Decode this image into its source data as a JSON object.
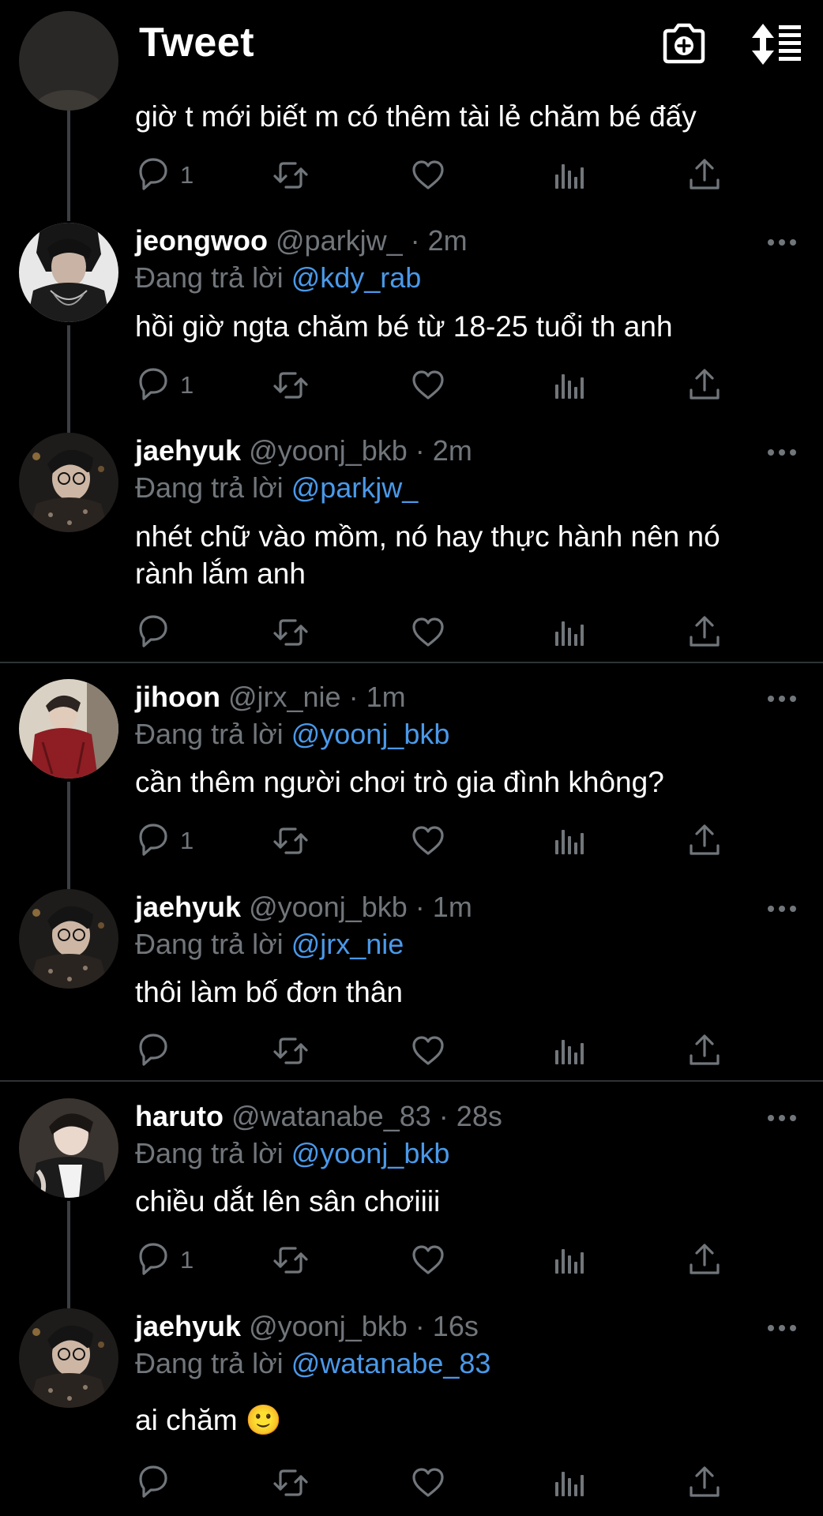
{
  "header": {
    "title": "Tweet",
    "back_icon": "chevron-left-icon",
    "camera_icon": "camera-plus-icon",
    "sort_icon": "sort-list-icon"
  },
  "colors": {
    "background": "#000000",
    "text": "#ffffff",
    "muted": "#71767b",
    "mention": "#4a99e9",
    "thread_line": "#3b3f44",
    "divider": "#2f3336"
  },
  "tweets": [
    {
      "partial": true,
      "text": "giờ t mới biết m có thêm tài lẻ chăm bé đấy",
      "reply_count": "1"
    },
    {
      "name": "jeongwoo",
      "handle": "@parkjw_",
      "sep": "·",
      "time": "2m",
      "reply_label": "Đang trả lời",
      "reply_to": "@kdy_rab",
      "text": "hồi giờ ngta chăm bé từ 18-25 tuổi th anh",
      "reply_count": "1"
    },
    {
      "name": "jaehyuk",
      "handle": "@yoonj_bkb",
      "sep": "·",
      "time": "2m",
      "reply_label": "Đang trả lời",
      "reply_to": "@parkjw_",
      "text": "nhét chữ vào mồm, nó hay thực hành nên nó rành lắm anh",
      "reply_count": ""
    },
    {
      "name": "jihoon",
      "handle": "@jrx_nie",
      "sep": "·",
      "time": "1m",
      "reply_label": "Đang trả lời",
      "reply_to": "@yoonj_bkb",
      "text": "cần thêm người chơi trò gia đình không?",
      "reply_count": "1"
    },
    {
      "name": "jaehyuk",
      "handle": "@yoonj_bkb",
      "sep": "·",
      "time": "1m",
      "reply_label": "Đang trả lời",
      "reply_to": "@jrx_nie",
      "text": "thôi làm bố đơn thân",
      "reply_count": ""
    },
    {
      "name": "haruto",
      "handle": "@watanabe_83",
      "sep": "·",
      "time": "28s",
      "reply_label": "Đang trả lời",
      "reply_to": "@yoonj_bkb",
      "text": "chiều dắt lên sân chơiiii",
      "reply_count": "1"
    },
    {
      "name": "jaehyuk",
      "handle": "@yoonj_bkb",
      "sep": "·",
      "time": "16s",
      "reply_label": "Đang trả lời",
      "reply_to": "@watanabe_83",
      "text": "ai chăm 🙂",
      "reply_count": ""
    }
  ]
}
